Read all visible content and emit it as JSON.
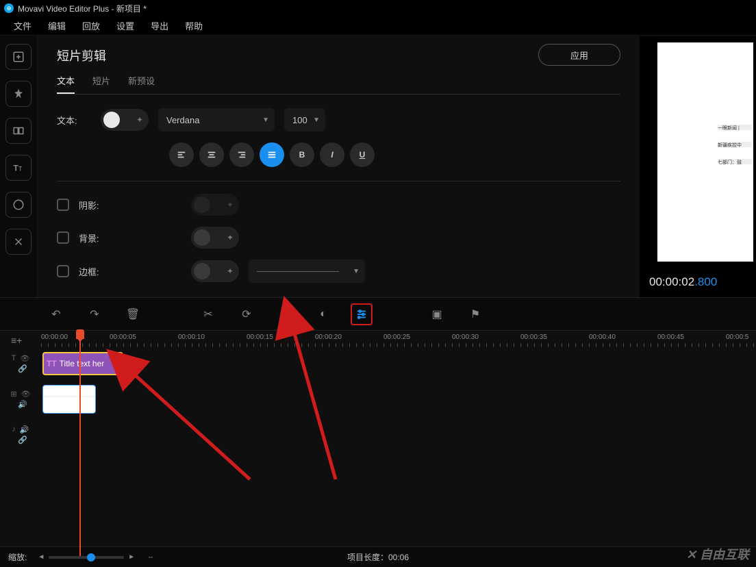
{
  "titlebar": {
    "app_name": "Movavi Video Editor Plus",
    "project": "新项目 *"
  },
  "menu": [
    "文件",
    "编辑",
    "回放",
    "设置",
    "导出",
    "帮助"
  ],
  "panel": {
    "title": "短片剪辑",
    "apply": "应用",
    "tabs": [
      "文本",
      "短片",
      "新预设"
    ],
    "text_label": "文本:",
    "font": "Verdana",
    "size": "100",
    "shadow_label": "阴影:",
    "background_label": "背景:",
    "border_label": "边框:",
    "bold": "B",
    "italic": "I",
    "underline": "U"
  },
  "preview": {
    "timestamp_main": "00:00:02",
    "timestamp_ms": ".800"
  },
  "ruler_marks": [
    {
      "label": "00:00:00",
      "pos": 60
    },
    {
      "label": "00:00:05",
      "pos": 160
    },
    {
      "label": "00:00:10",
      "pos": 260
    },
    {
      "label": "00:00:15",
      "pos": 360
    },
    {
      "label": "00:00:20",
      "pos": 460
    },
    {
      "label": "00:00:25",
      "pos": 560
    },
    {
      "label": "00:00:30",
      "pos": 660
    },
    {
      "label": "00:00:35",
      "pos": 760
    },
    {
      "label": "00:00:40",
      "pos": 860
    },
    {
      "label": "00:00:45",
      "pos": 960
    },
    {
      "label": "00:00:5",
      "pos": 1060
    }
  ],
  "clip": {
    "title_text": "Title text her"
  },
  "footer": {
    "zoom_label": "缩放:",
    "duration_label": "项目长度：",
    "duration_value": "00:06"
  },
  "watermark": "✕ 自由互联"
}
